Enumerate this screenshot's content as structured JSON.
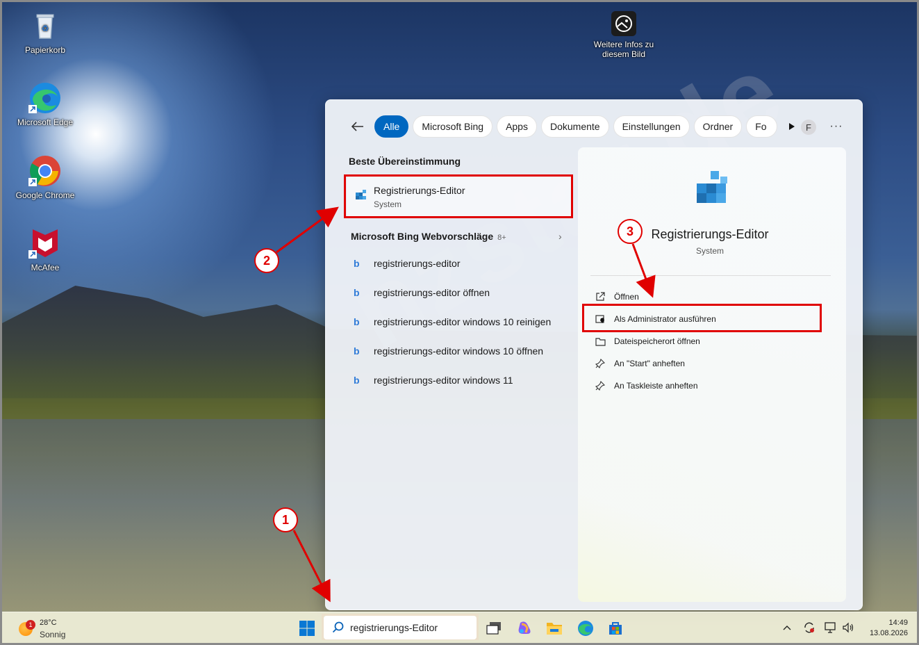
{
  "desktop": {
    "icons": [
      {
        "label": "Papierkorb"
      },
      {
        "label": "Microsoft Edge"
      },
      {
        "label": "Google Chrome"
      },
      {
        "label": "McAfee"
      }
    ],
    "info_icon_label": "Weitere Infos zu diesem Bild",
    "watermark": "nzstar.de"
  },
  "search": {
    "filters": [
      "Alle",
      "Microsoft Bing",
      "Apps",
      "Dokumente",
      "Einstellungen",
      "Ordner",
      "Fo"
    ],
    "active_filter": "Alle",
    "user_initial": "F",
    "best_match_title": "Beste Übereinstimmung",
    "best_match": {
      "name": "Registrierungs-Editor",
      "type": "System"
    },
    "web_section_title": "Microsoft Bing Webvorschläge",
    "web_section_count": "8+",
    "web_results": [
      "registrierungs-editor",
      "registrierungs-editor öffnen",
      "registrierungs-editor windows 10 reinigen",
      "registrierungs-editor windows 10 öffnen",
      "registrierungs-editor windows 11"
    ],
    "detail": {
      "name": "Registrierungs-Editor",
      "type": "System",
      "actions": [
        {
          "label": "Öffnen",
          "icon": "open-external-icon"
        },
        {
          "label": "Als Administrator ausführen",
          "icon": "admin-shield-icon"
        },
        {
          "label": "Dateispeicherort öffnen",
          "icon": "folder-icon"
        },
        {
          "label": "An \"Start\" anheften",
          "icon": "pin-icon"
        },
        {
          "label": "An Taskleiste anheften",
          "icon": "pin-icon"
        }
      ]
    }
  },
  "annotations": {
    "step1": "1",
    "step2": "2",
    "step3": "3",
    "color": "#e00000"
  },
  "taskbar": {
    "weather_temp": "28°C",
    "weather_cond": "Sonnig",
    "weather_badge": "1",
    "search_query": "registrierungs-Editor",
    "time": "14:49",
    "date": "13.08.2026"
  },
  "colors": {
    "accent": "#0067c0",
    "annotation": "#e00000"
  }
}
